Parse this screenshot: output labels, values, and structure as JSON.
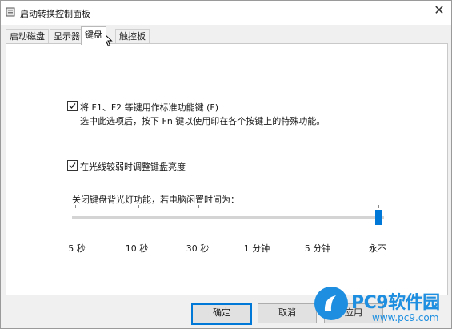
{
  "window": {
    "title": "启动转换控制面板",
    "close_glyph": "✕"
  },
  "tabs": [
    {
      "label": "启动磁盘",
      "active": false
    },
    {
      "label": "显示器",
      "active": false
    },
    {
      "label": "键盘",
      "active": true
    },
    {
      "label": "触控板",
      "active": false
    }
  ],
  "keyboard": {
    "fn_keys": {
      "checked": true,
      "label": "将 F1、F2 等键用作标准功能键 (F)",
      "description": "选中此选项后，按下 Fn 键以使用印在各个按键上的特殊功能。"
    },
    "low_light": {
      "checked": true,
      "label": "在光线较弱时调整键盘亮度"
    },
    "backlight": {
      "label": "关闭键盘背光灯功能，若电脑闲置时间为：",
      "tick_labels": [
        "5 秒",
        "10 秒",
        "30 秒",
        "1 分钟",
        "5 分钟",
        "永不"
      ],
      "selected": "永不"
    }
  },
  "buttons": {
    "ok": "确定",
    "cancel": "取消",
    "apply": "应用"
  },
  "watermark": {
    "text": "PC9软件园",
    "url": "www.pc9.com"
  },
  "colors": {
    "accent": "#0078d7",
    "watermark": "#1e8fe0"
  }
}
